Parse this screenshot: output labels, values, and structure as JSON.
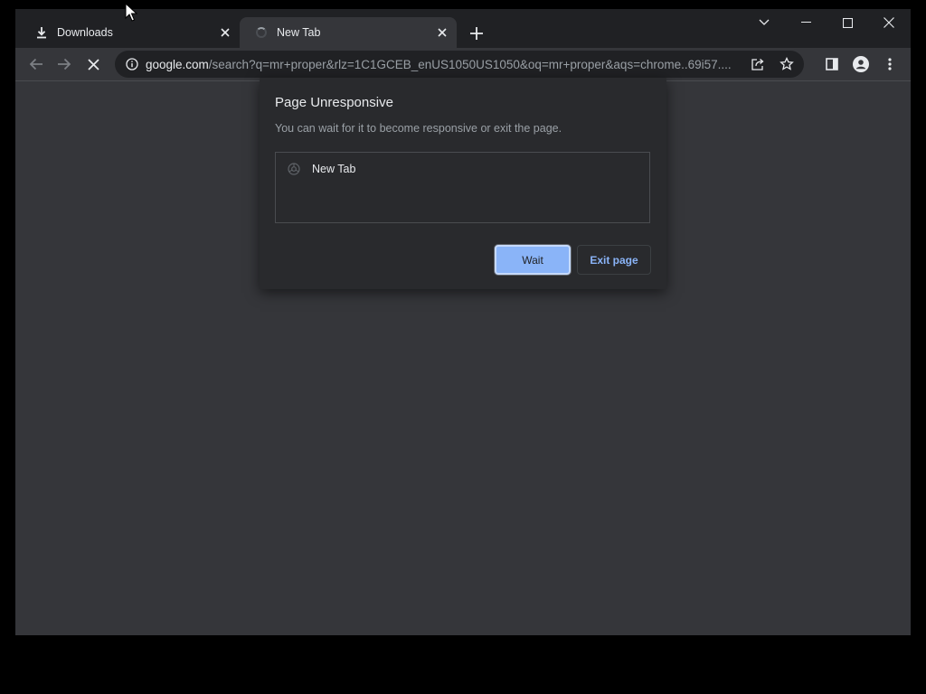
{
  "tabs": [
    {
      "label": "Downloads",
      "icon": "download-icon"
    },
    {
      "label": "New Tab",
      "icon": "loading-spinner-icon",
      "active": true
    }
  ],
  "window_controls": [
    "tab-search-icon",
    "minimize-icon",
    "maximize-icon",
    "close-icon"
  ],
  "toolbar": {
    "url_host": "google.com",
    "url_rest": "/search?q=mr+proper&rlz=1C1GCEB_enUS1050US1050&oq=mr+proper&aqs=chrome..69i57....",
    "icons": [
      "back-arrow-icon",
      "forward-arrow-icon",
      "stop-loading-icon",
      "site-info-icon",
      "share-icon",
      "bookmark-star-icon",
      "side-panel-icon",
      "profile-icon",
      "menu-icon"
    ]
  },
  "dialog": {
    "title": "Page Unresponsive",
    "message": "You can wait for it to become responsive or exit the page.",
    "items": [
      {
        "label": "New Tab",
        "icon": "page-favicon-icon"
      }
    ],
    "wait_label": "Wait",
    "exit_label": "Exit page"
  },
  "colors": {
    "frame": "#202124",
    "toolbar": "#35363a",
    "dialog": "#292a2d",
    "accent": "#8ab4f8",
    "text": "#e8eaed",
    "text_secondary": "#9aa0a6"
  }
}
